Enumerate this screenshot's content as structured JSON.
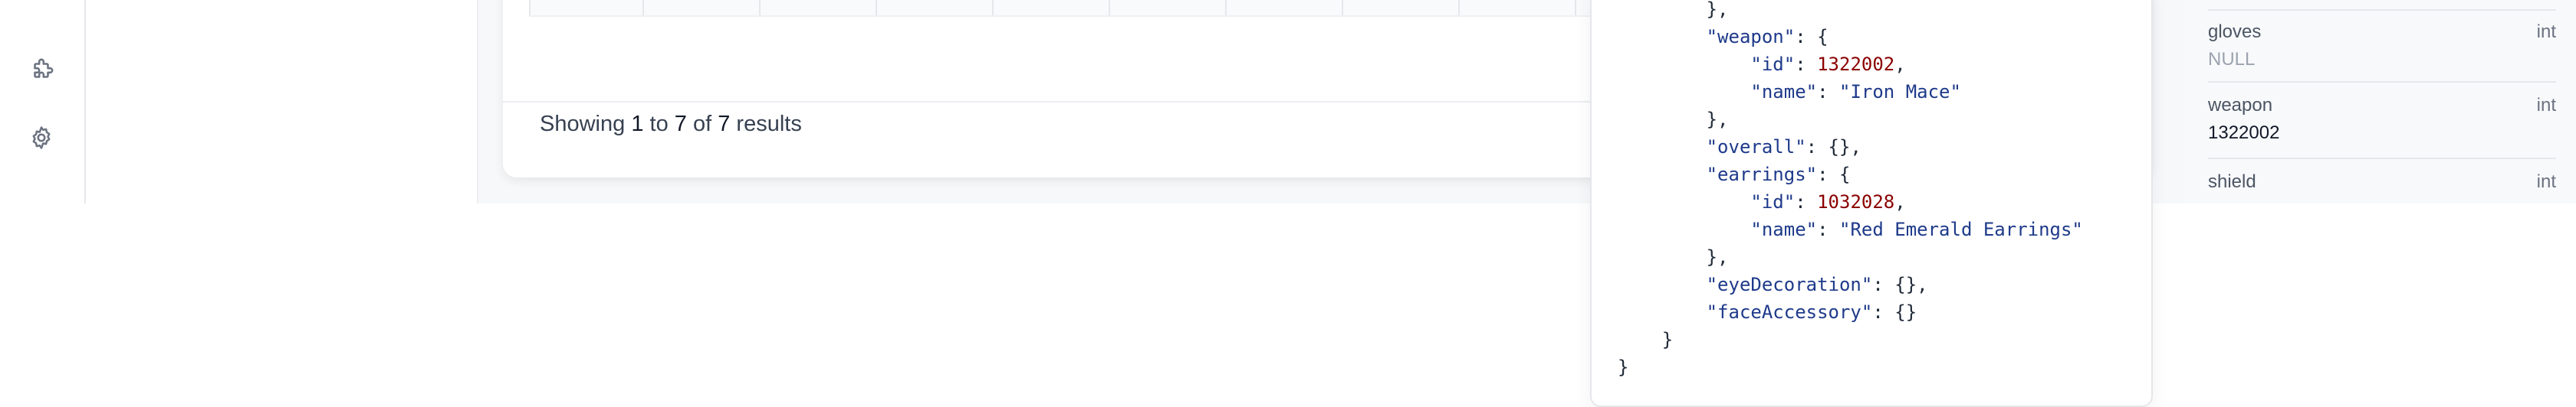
{
  "sidebar": {
    "icons": [
      {
        "name": "extensions-icon"
      },
      {
        "name": "settings-icon"
      }
    ]
  },
  "results": {
    "prefix": "Showing",
    "from": "1",
    "to_word": "to",
    "to": "7",
    "of_word": "of",
    "total": "7",
    "suffix": "results"
  },
  "json_view": {
    "lines": [
      [
        {
          "t": "p",
          "v": "        },"
        }
      ],
      [
        {
          "t": "p",
          "v": "        "
        },
        {
          "t": "k",
          "v": "\"weapon\""
        },
        {
          "t": "p",
          "v": ": {"
        }
      ],
      [
        {
          "t": "p",
          "v": "            "
        },
        {
          "t": "k",
          "v": "\"id\""
        },
        {
          "t": "p",
          "v": ": "
        },
        {
          "t": "n",
          "v": "1322002"
        },
        {
          "t": "p",
          "v": ","
        }
      ],
      [
        {
          "t": "p",
          "v": "            "
        },
        {
          "t": "k",
          "v": "\"name\""
        },
        {
          "t": "p",
          "v": ": "
        },
        {
          "t": "s",
          "v": "\"Iron Mace\""
        }
      ],
      [
        {
          "t": "p",
          "v": "        },"
        }
      ],
      [
        {
          "t": "p",
          "v": "        "
        },
        {
          "t": "k",
          "v": "\"overall\""
        },
        {
          "t": "p",
          "v": ": {},"
        }
      ],
      [
        {
          "t": "p",
          "v": "        "
        },
        {
          "t": "k",
          "v": "\"earrings\""
        },
        {
          "t": "p",
          "v": ": {"
        }
      ],
      [
        {
          "t": "p",
          "v": "            "
        },
        {
          "t": "k",
          "v": "\"id\""
        },
        {
          "t": "p",
          "v": ": "
        },
        {
          "t": "n",
          "v": "1032028"
        },
        {
          "t": "p",
          "v": ","
        }
      ],
      [
        {
          "t": "p",
          "v": "            "
        },
        {
          "t": "k",
          "v": "\"name\""
        },
        {
          "t": "p",
          "v": ": "
        },
        {
          "t": "s",
          "v": "\"Red Emerald Earrings\""
        }
      ],
      [
        {
          "t": "p",
          "v": "        },"
        }
      ],
      [
        {
          "t": "p",
          "v": "        "
        },
        {
          "t": "k",
          "v": "\"eyeDecoration\""
        },
        {
          "t": "p",
          "v": ": {},"
        }
      ],
      [
        {
          "t": "p",
          "v": "        "
        },
        {
          "t": "k",
          "v": "\"faceAccessory\""
        },
        {
          "t": "p",
          "v": ": {}"
        }
      ],
      [
        {
          "t": "p",
          "v": "    }"
        }
      ],
      [
        {
          "t": "p",
          "v": "}"
        }
      ]
    ]
  },
  "schema": {
    "fields": [
      {
        "name": "gloves",
        "type": "int",
        "value": "NULL",
        "is_null": true
      },
      {
        "name": "weapon",
        "type": "int",
        "value": "1322002",
        "is_null": false
      },
      {
        "name": "shield",
        "type": "int",
        "value": "",
        "is_null": false
      }
    ]
  },
  "colors": {
    "json_key": "#1e3a8a",
    "json_number": "#8b0000",
    "json_string": "#1e3a8a"
  }
}
